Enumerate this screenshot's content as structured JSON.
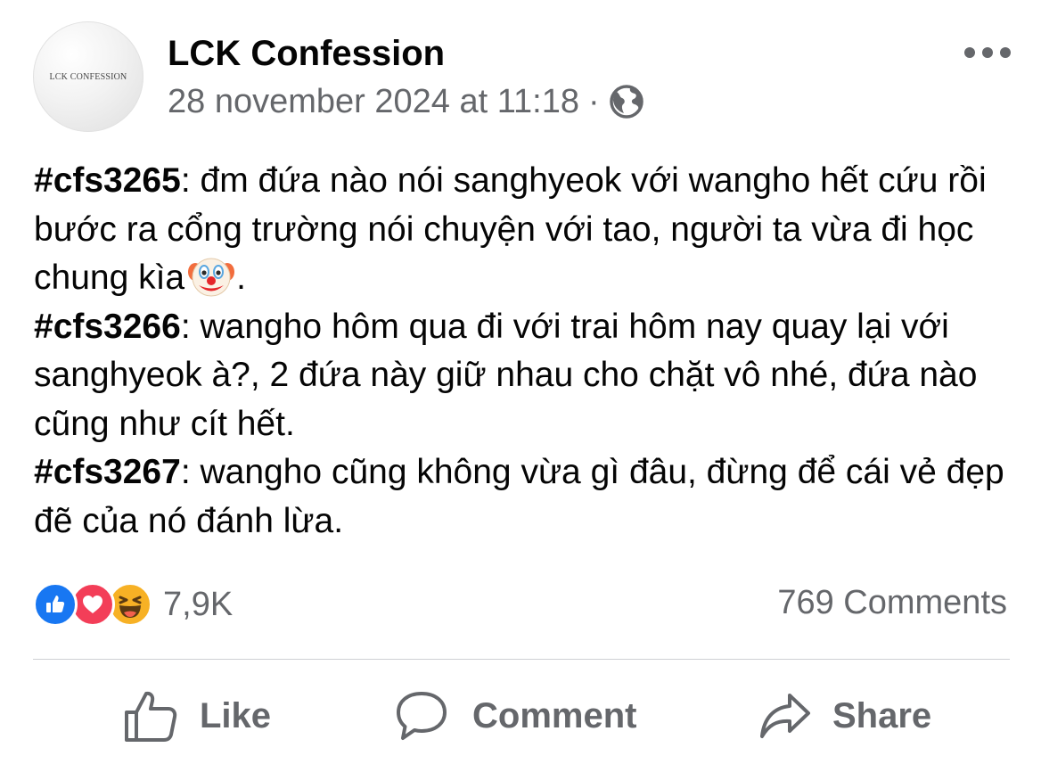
{
  "post": {
    "author": {
      "name": "LCK Confession",
      "avatar_text": "LCK CONFESSION"
    },
    "timestamp": "28 november 2024 at 11:18",
    "separator": "·",
    "privacy_icon": "globe-icon",
    "menu_icon": "more-horizontal-icon",
    "content": [
      {
        "tag": "#cfs3265",
        "text": ": đm đứa nào nói sanghyeok với wangho hết cứu rồi bước ra cổng trường nói chuyện với tao, người ta vừa đi học chung kìa",
        "trailing_emoji": "clown-face-emoji",
        "trailing_text": "."
      },
      {
        "tag": "#cfs3266",
        "text": ": wangho hôm qua đi với trai hôm nay quay lại với sanghyeok à?, 2 đứa này giữ nhau cho chặt vô nhé, đứa nào cũng như cít hết."
      },
      {
        "tag": "#cfs3267",
        "text": ": wangho cũng không vừa gì đâu, đừng để cái vẻ đẹp đẽ của nó đánh lừa."
      }
    ]
  },
  "reactions": {
    "icons": [
      "like-reaction-icon",
      "love-reaction-icon",
      "haha-reaction-icon"
    ],
    "count": "7,9K"
  },
  "comments": {
    "count_label": "769 Comments"
  },
  "actions": {
    "like": "Like",
    "comment": "Comment",
    "share": "Share"
  },
  "colors": {
    "text_primary": "#050505",
    "text_secondary": "#65676b",
    "like_blue": "#1877f2",
    "love_red": "#f33e58",
    "haha_yellow": "#f7b125",
    "divider": "#ced0d4"
  }
}
